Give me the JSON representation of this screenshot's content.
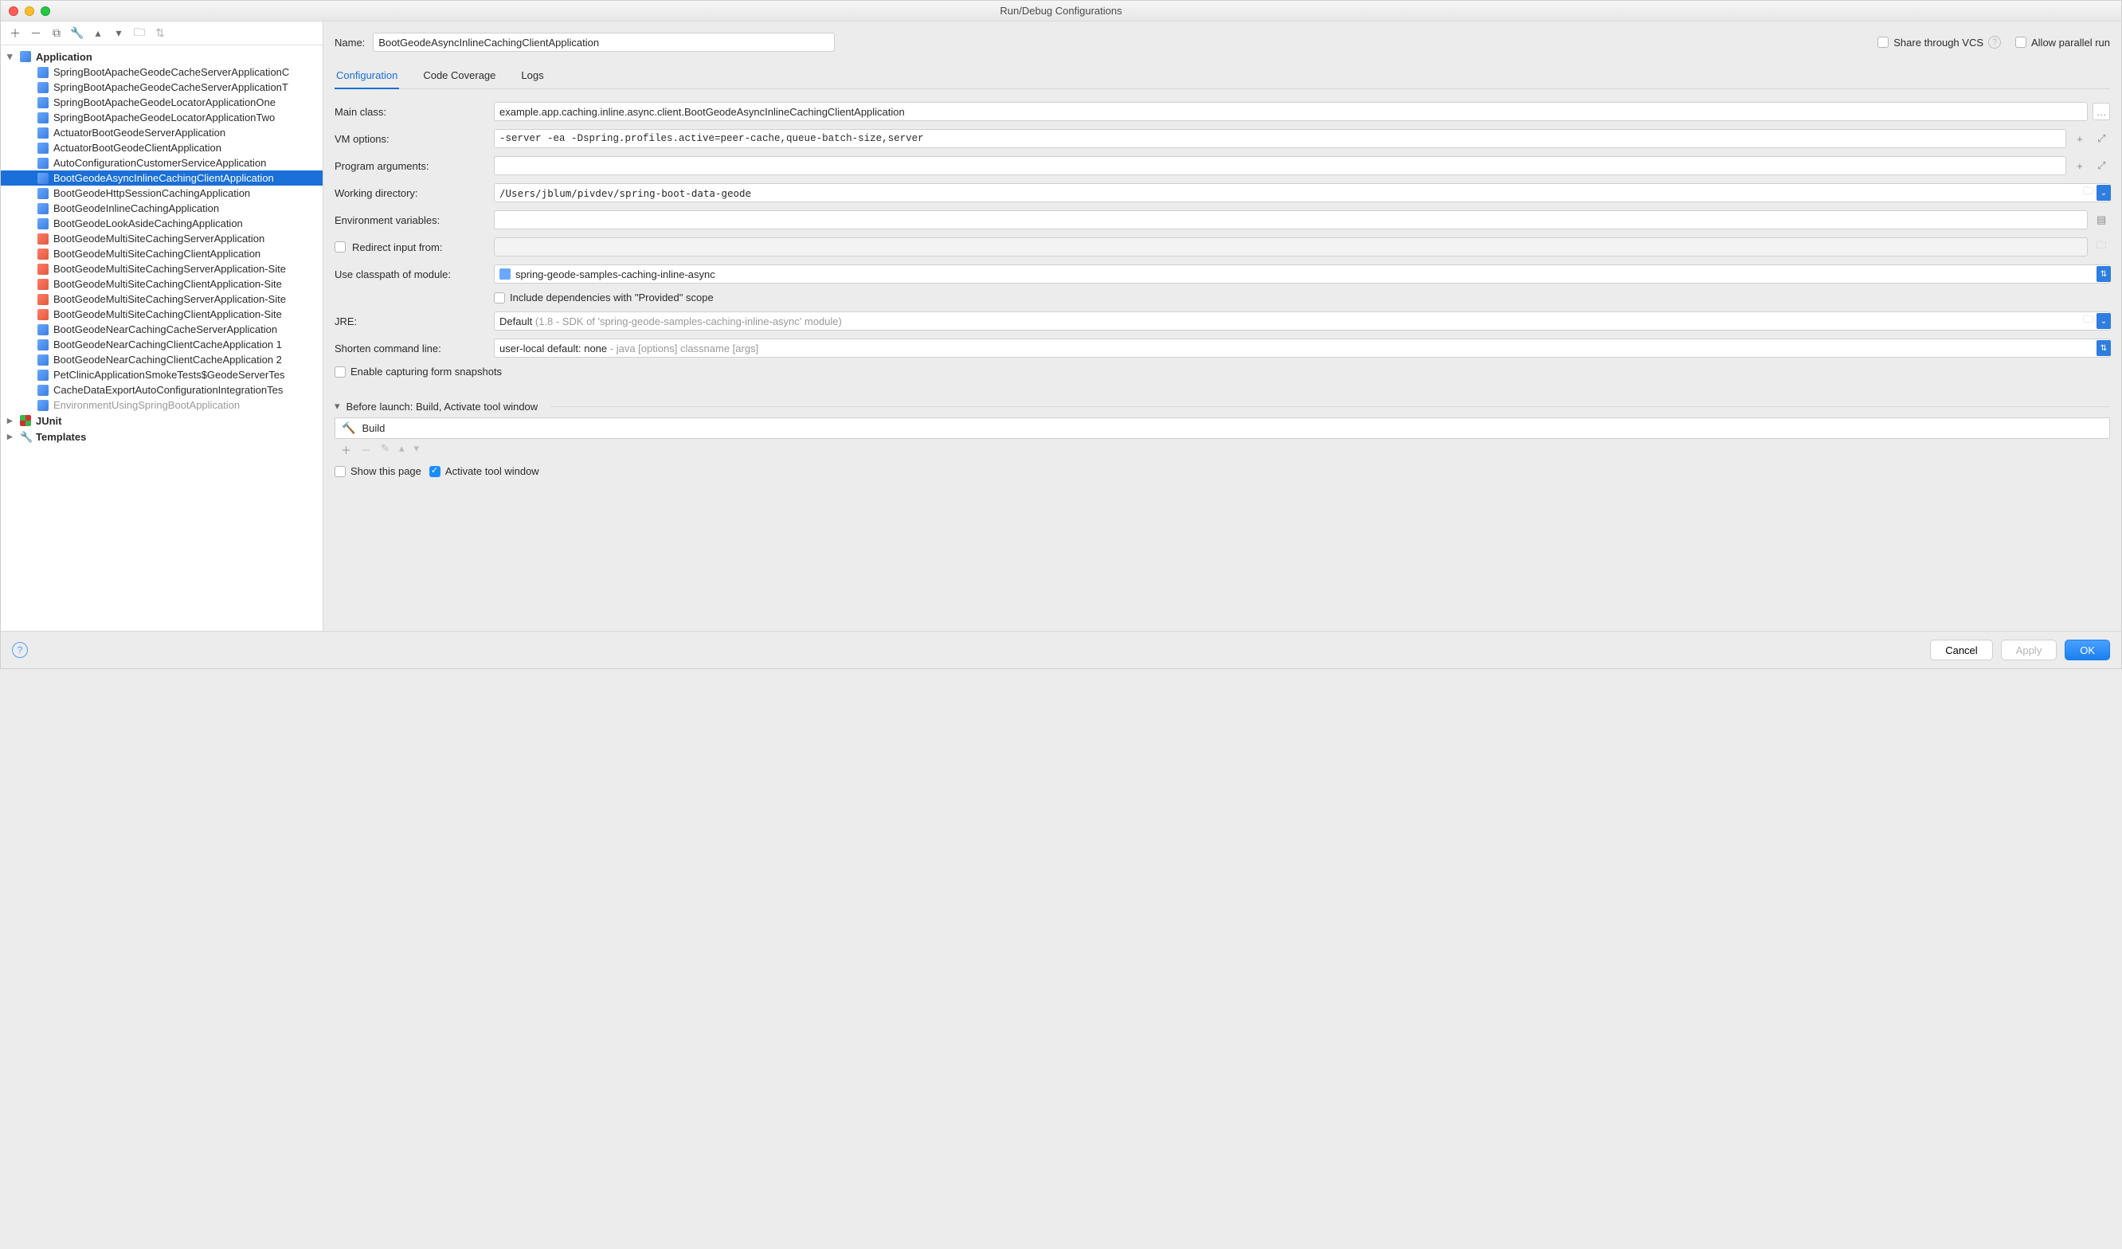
{
  "window": {
    "title": "Run/Debug Configurations"
  },
  "nameLabel": "Name:",
  "nameValue": "BootGeodeAsyncInlineCachingClientApplication",
  "shareVCS": "Share through VCS",
  "allowParallel": "Allow parallel run",
  "tree": {
    "application": "Application",
    "items": [
      "SpringBootApacheGeodeCacheServerApplicationC",
      "SpringBootApacheGeodeCacheServerApplicationT",
      "SpringBootApacheGeodeLocatorApplicationOne",
      "SpringBootApacheGeodeLocatorApplicationTwo",
      "ActuatorBootGeodeServerApplication",
      "ActuatorBootGeodeClientApplication",
      "AutoConfigurationCustomerServiceApplication",
      "BootGeodeAsyncInlineCachingClientApplication",
      "BootGeodeHttpSessionCachingApplication",
      "BootGeodeInlineCachingApplication",
      "BootGeodeLookAsideCachingApplication",
      "BootGeodeMultiSiteCachingServerApplication",
      "BootGeodeMultiSiteCachingClientApplication",
      "BootGeodeMultiSiteCachingServerApplication-Site",
      "BootGeodeMultiSiteCachingClientApplication-Site",
      "BootGeodeMultiSiteCachingServerApplication-Site",
      "BootGeodeMultiSiteCachingClientApplication-Site",
      "BootGeodeNearCachingCacheServerApplication",
      "BootGeodeNearCachingClientCacheApplication 1",
      "BootGeodeNearCachingClientCacheApplication 2",
      "PetClinicApplicationSmokeTests$GeodeServerTes",
      "CacheDataExportAutoConfigurationIntegrationTes",
      "EnvironmentUsingSpringBootApplication"
    ],
    "junit": "JUnit",
    "templates": "Templates"
  },
  "tabs": {
    "config": "Configuration",
    "cov": "Code Coverage",
    "logs": "Logs"
  },
  "form": {
    "mainClassLabel": "Main class:",
    "mainClass": "example.app.caching.inline.async.client.BootGeodeAsyncInlineCachingClientApplication",
    "vmLabel": "VM options:",
    "vm": "-server -ea -Dspring.profiles.active=peer-cache,queue-batch-size,server",
    "argsLabel": "Program arguments:",
    "args": "",
    "wdLabel": "Working directory:",
    "wd": "/Users/jblum/pivdev/spring-boot-data-geode",
    "envLabel": "Environment variables:",
    "env": "",
    "redirect": "Redirect input from:",
    "classpathLabel": "Use classpath of module:",
    "classpath": "spring-geode-samples-caching-inline-async",
    "includeProvided": "Include dependencies with \"Provided\" scope",
    "jreLabel": "JRE:",
    "jrePrefix": "Default",
    "jreSuffix": "(1.8 - SDK of 'spring-geode-samples-caching-inline-async' module)",
    "shortenLabel": "Shorten command line:",
    "shortenPrefix": "user-local default: none",
    "shortenSuffix": "- java [options] classname [args]",
    "snapshots": "Enable capturing form snapshots"
  },
  "before": {
    "header": "Before launch: Build, Activate tool window",
    "build": "Build",
    "showPage": "Show this page",
    "activate": "Activate tool window"
  },
  "footer": {
    "cancel": "Cancel",
    "apply": "Apply",
    "ok": "OK"
  }
}
